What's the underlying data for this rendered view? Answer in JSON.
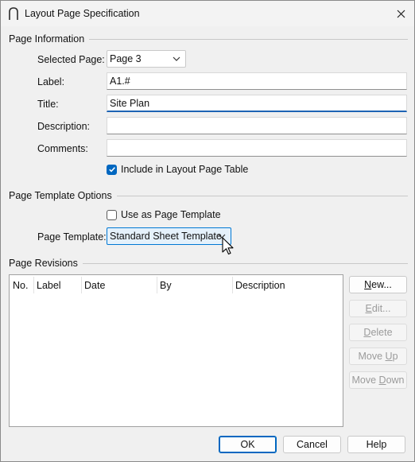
{
  "window": {
    "title": "Layout Page Specification",
    "app_icon": "arch-icon",
    "close_icon": "close-icon"
  },
  "page_information": {
    "group_title": "Page Information",
    "selected_page_label": "Selected Page:",
    "selected_page_value": "Page 3",
    "label_label": "Label:",
    "label_value": "A1.#",
    "title_label": "Title:",
    "title_value": "Site Plan",
    "description_label": "Description:",
    "description_value": "",
    "comments_label": "Comments:",
    "comments_value": "",
    "include_label": "Include in Layout Page Table",
    "include_checked": true
  },
  "template_options": {
    "group_title": "Page Template Options",
    "use_as_template_label": "Use as Page Template",
    "use_as_template_checked": false,
    "page_template_label": "Page Template:",
    "page_template_value": "Standard Sheet Template"
  },
  "revisions": {
    "group_title": "Page Revisions",
    "columns": [
      "No.",
      "Label",
      "Date",
      "By",
      "Description"
    ],
    "rows": [],
    "buttons": {
      "new": {
        "pre": "",
        "accel": "N",
        "post": "ew..."
      },
      "edit": {
        "pre": "",
        "accel": "E",
        "post": "dit..."
      },
      "delete": {
        "pre": "",
        "accel": "D",
        "post": "elete"
      },
      "move_up": {
        "pre": "Move ",
        "accel": "U",
        "post": "p"
      },
      "move_down": {
        "pre": "Move ",
        "accel": "D",
        "post": "own"
      }
    }
  },
  "footer": {
    "ok": "OK",
    "cancel": "Cancel",
    "help": "Help"
  },
  "colors": {
    "accent": "#0067c0",
    "focus_underline": "#1e64b4",
    "hot_combo_bg": "#e5f1fb"
  }
}
